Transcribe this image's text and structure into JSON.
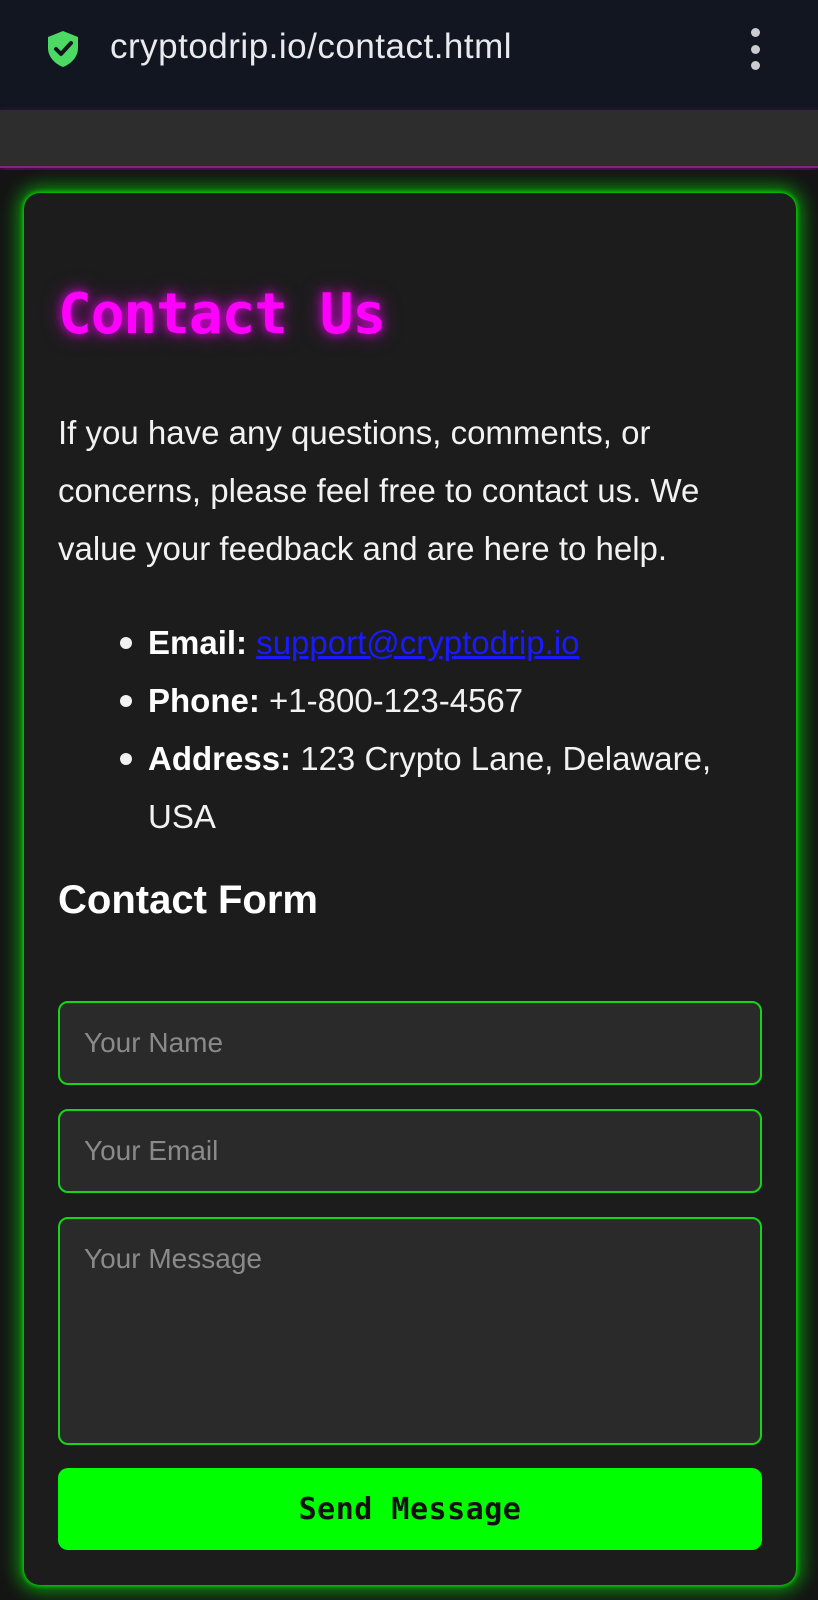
{
  "browser": {
    "url": "cryptodrip.io/contact.html",
    "secure_icon": "shield-check-icon",
    "menu_icon": "kebab-menu-icon"
  },
  "contact": {
    "title": "Contact Us",
    "intro": "If you have any questions, comments, or concerns, please feel free to contact us. We value your feedback and are here to help.",
    "items": [
      {
        "label": "Email:",
        "value": "support@cryptodrip.io"
      },
      {
        "label": "Phone:",
        "value": "+1-800-123-4567"
      },
      {
        "label": "Address:",
        "value": "123 Crypto Lane, Delaware, USA"
      }
    ]
  },
  "form": {
    "title": "Contact Form",
    "name_placeholder": "Your Name",
    "email_placeholder": "Your Email",
    "message_placeholder": "Your Message",
    "submit_label": "Send Message"
  },
  "colors": {
    "accent_green": "#00ff00",
    "title_magenta": "#ff00ff",
    "link_blue": "#1a1aff",
    "card_bg": "#1c1c1c"
  }
}
